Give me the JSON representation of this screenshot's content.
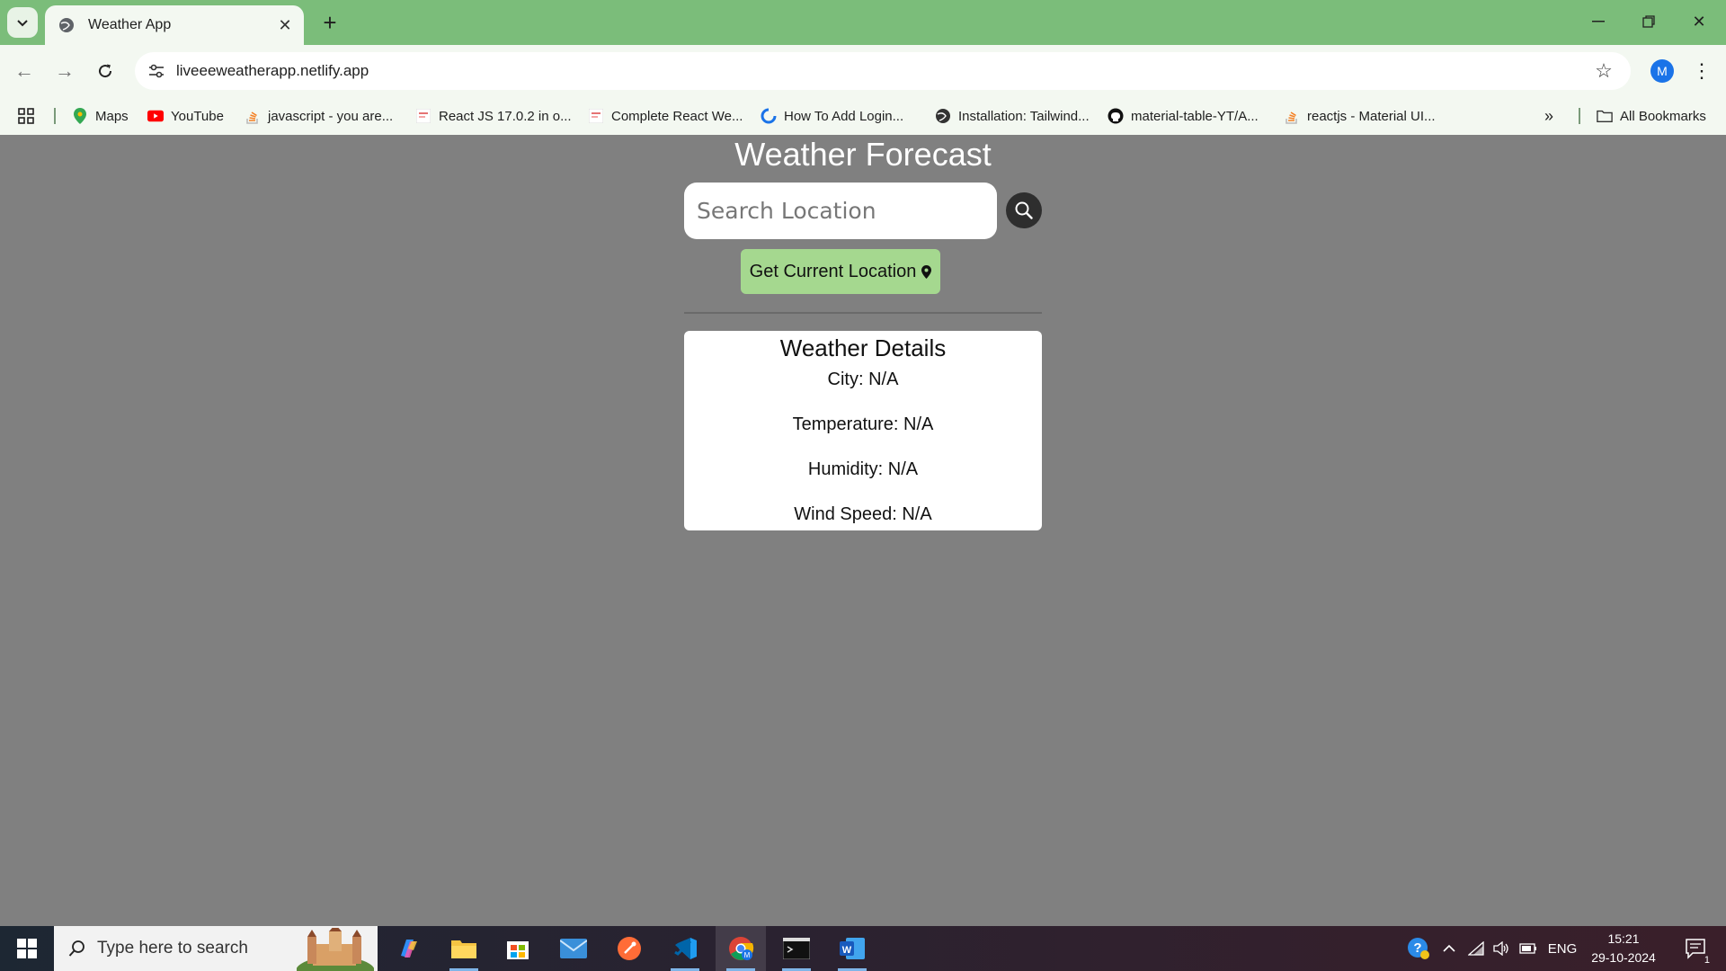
{
  "browser": {
    "tab_title": "Weather App",
    "url": "liveeeweatherapp.netlify.app",
    "profile_initial": "M",
    "bookmarks": [
      {
        "label": "Maps",
        "icon": "maps-pin-icon"
      },
      {
        "label": "YouTube",
        "icon": "youtube-icon"
      },
      {
        "label": "javascript - you are...",
        "icon": "stackoverflow-icon"
      },
      {
        "label": "React JS 17.0.2 in o...",
        "icon": "page-icon"
      },
      {
        "label": "Complete React We...",
        "icon": "page-icon"
      },
      {
        "label": "How To Add Login...",
        "icon": "loop-icon"
      },
      {
        "label": "Installation: Tailwind...",
        "icon": "globe-icon"
      },
      {
        "label": "material-table-YT/A...",
        "icon": "github-icon"
      },
      {
        "label": "reactjs - Material UI...",
        "icon": "stackoverflow-icon"
      }
    ],
    "all_bookmarks_label": "All Bookmarks"
  },
  "app": {
    "title": "Weather Forecast",
    "search_placeholder": "Search Location",
    "location_button": "Get Current Location",
    "details": {
      "heading": "Weather Details",
      "city": "City: N/A",
      "temperature": "Temperature: N/A",
      "humidity": "Humidity: N/A",
      "wind_speed": "Wind Speed: N/A"
    }
  },
  "taskbar": {
    "search_placeholder": "Type here to search",
    "language": "ENG",
    "time": "15:21",
    "date": "29-10-2024",
    "notification_count": "1"
  },
  "colors": {
    "tab_strip": "#7bbd7a",
    "page_background": "#808080",
    "location_button": "#a5d88f"
  }
}
